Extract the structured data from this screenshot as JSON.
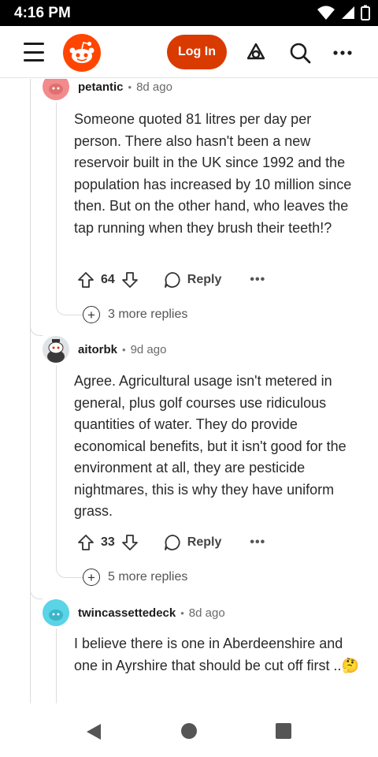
{
  "status": {
    "time": "4:16 PM"
  },
  "header": {
    "login_label": "Log In"
  },
  "comments": [
    {
      "username": "petantic",
      "age": "8d ago",
      "body": "Someone quoted 81 litres per day per person. There also hasn't been a new reservoir built in the UK since 1992 and the population has increased by 10 million since then. But on the other hand, who leaves the tap running when they brush their teeth!?",
      "votes": "64",
      "reply_label": "Reply",
      "more_replies": "3 more replies",
      "avatar_color": "#f28b8b"
    },
    {
      "username": "aitorbk",
      "age": "9d ago",
      "body": "Agree. Agricultural usage isn't metered in general, plus golf courses use ridiculous quantities of water. They do provide economical benefits, but it isn't good for the environment at all, they are pesticide nightmares, this is why they have uniform grass.",
      "votes": "33",
      "reply_label": "Reply",
      "more_replies": "5 more replies",
      "avatar_color": "#3a3a3a"
    },
    {
      "username": "twincassettedeck",
      "age": "8d ago",
      "body": "I believe there is one in Aberdeenshire and one in Ayrshire that should be cut off first ..🤔",
      "avatar_color": "#5ad4e6"
    }
  ],
  "colors": {
    "brand": "#ff4500",
    "login_button": "#d93a00"
  }
}
